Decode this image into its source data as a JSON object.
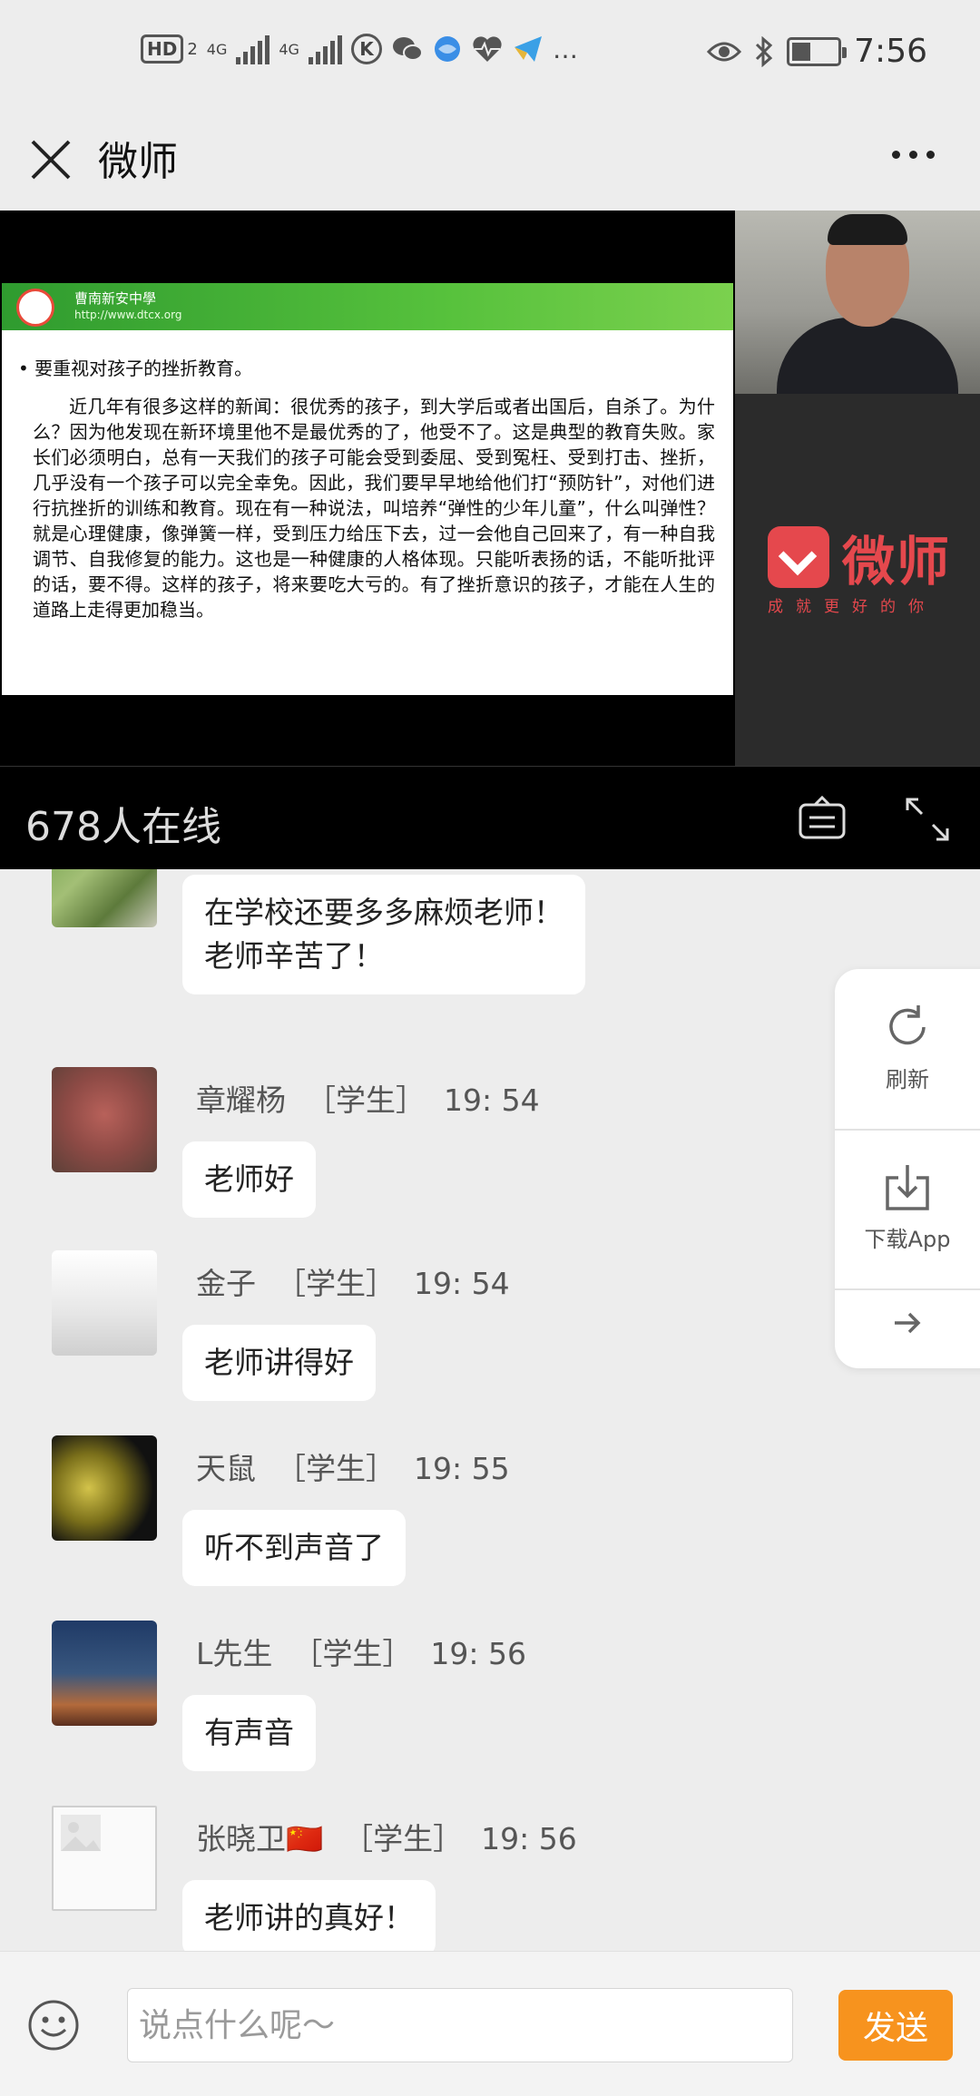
{
  "status_bar": {
    "left_items": [
      "HD",
      "2",
      "4G",
      "4G",
      "K",
      "wechat",
      "safari",
      "heart-pulse",
      "paper-plane",
      "…"
    ],
    "time": "7:56"
  },
  "title_bar": {
    "title": "微师"
  },
  "slide": {
    "school_name": "曹南新安中學",
    "school_url": "http://www.dtcx.org",
    "bullet": "要重视对孩子的挫折教育。",
    "body": "近几年有很多这样的新闻：很优秀的孩子，到大学后或者出国后，自杀了。为什么？因为他发现在新环境里他不是最优秀的了，他受不了。这是典型的教育失败。家长们必须明白，总有一天我们的孩子可能会受到委屈、受到冤枉、受到打击、挫折，几乎没有一个孩子可以完全幸免。因此，我们要早早地给他们打“预防针”，对他们进行抗挫折的训练和教育。现在有一种说法，叫培养“弹性的少年儿童”，什么叫弹性？就是心理健康，像弹簧一样，受到压力给压下去，过一会他自己回来了，有一种自我调节、自我修复的能力。这也是一种健康的人格体现。只能听表扬的话，不能听批评的话，要不得。这样的孩子，将来要吃大亏的。有了挫折意识的孩子，才能在人生的道路上走得更加稳当。"
  },
  "brand": {
    "name": "微师",
    "slogan": "成就更好的你",
    "color": "#e5484d"
  },
  "online": {
    "text": "678人在线"
  },
  "chat": {
    "messages": [
      {
        "name": "",
        "role": "",
        "time": "",
        "text": "在学校还要多多麻烦老师！\n老师辛苦了！"
      },
      {
        "name": "章耀杨",
        "role": "［学生］",
        "time": "19: 54",
        "text": "老师好"
      },
      {
        "name": "金子",
        "role": "［学生］",
        "time": "19: 54",
        "text": "老师讲得好"
      },
      {
        "name": "天鼠",
        "role": "［学生］",
        "time": "19: 55",
        "text": "听不到声音了"
      },
      {
        "name": "L先生",
        "role": "［学生］",
        "time": "19: 56",
        "text": "有声音"
      },
      {
        "name": "张晓卫🇨🇳",
        "role": "［学生］",
        "time": "19: 56",
        "text": "老师讲的真好！"
      }
    ]
  },
  "side_panel": {
    "refresh_label": "刷新",
    "download_label": "下载App"
  },
  "input_bar": {
    "placeholder": "说点什么呢～",
    "send_label": "发送",
    "send_color": "#f7931e"
  }
}
